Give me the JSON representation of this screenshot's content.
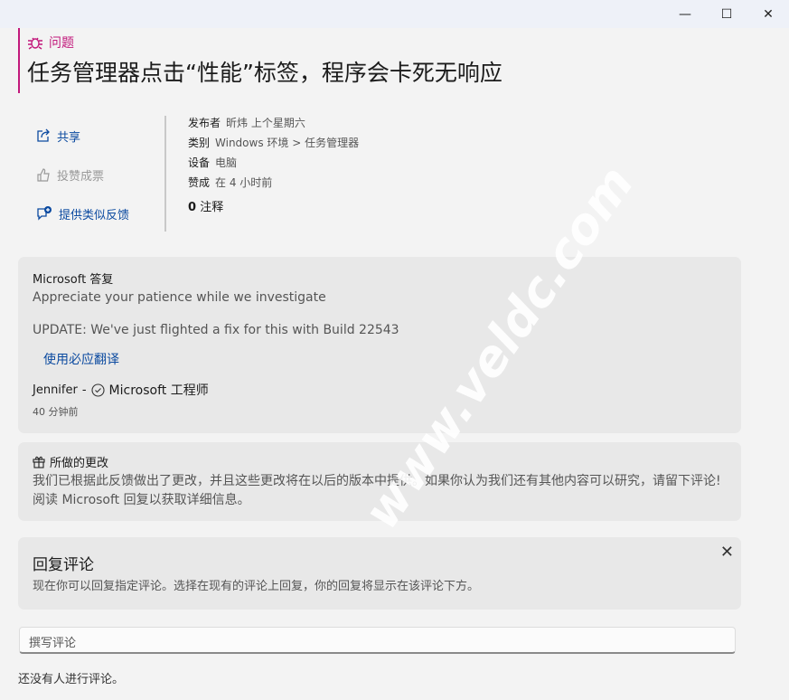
{
  "window": {
    "minimize": "—",
    "maximize": "☐",
    "close": "✕"
  },
  "header": {
    "kind": "问题",
    "title": "任务管理器点击“性能”标签，程序会卡死无响应"
  },
  "actions": {
    "share": "共享",
    "vote": "投赞成票",
    "similar": "提供类似反馈"
  },
  "meta": {
    "publisher_label": "发布者",
    "publisher": "昕炜 上个星期六",
    "category_label": "类别",
    "category": "Windows 环境 > 任务管理器",
    "device_label": "设备",
    "device": "电脑",
    "upvote_label": "赞成",
    "upvote": "在 4 小时前",
    "comments_count": "0",
    "comments_label": "注释"
  },
  "response": {
    "heading": "Microsoft 答复",
    "line1": "Appreciate your patience while we investigate",
    "line2": "UPDATE: We've just flighted a fix for this with Build 22543",
    "translate": "使用必应翻译",
    "author": "Jennifer",
    "sep": "-",
    "role": "Microsoft 工程师",
    "time": "40 分钟前"
  },
  "changes": {
    "heading": "所做的更改",
    "body": "我们已根据此反馈做出了更改，并且这些更改将在以后的版本中提供。如果你认为我们还有其他内容可以研究，请留下评论! 阅读 Microsoft 回复以获取详细信息。"
  },
  "reply_tip": {
    "heading": "回复评论",
    "body": "现在你可以回复指定评论。选择在现有的评论上回复，你的回复将显示在该评论下方。"
  },
  "comment": {
    "placeholder": "撰写评论",
    "empty": "还没有人进行评论。"
  },
  "watermark": "www.veldc.com"
}
